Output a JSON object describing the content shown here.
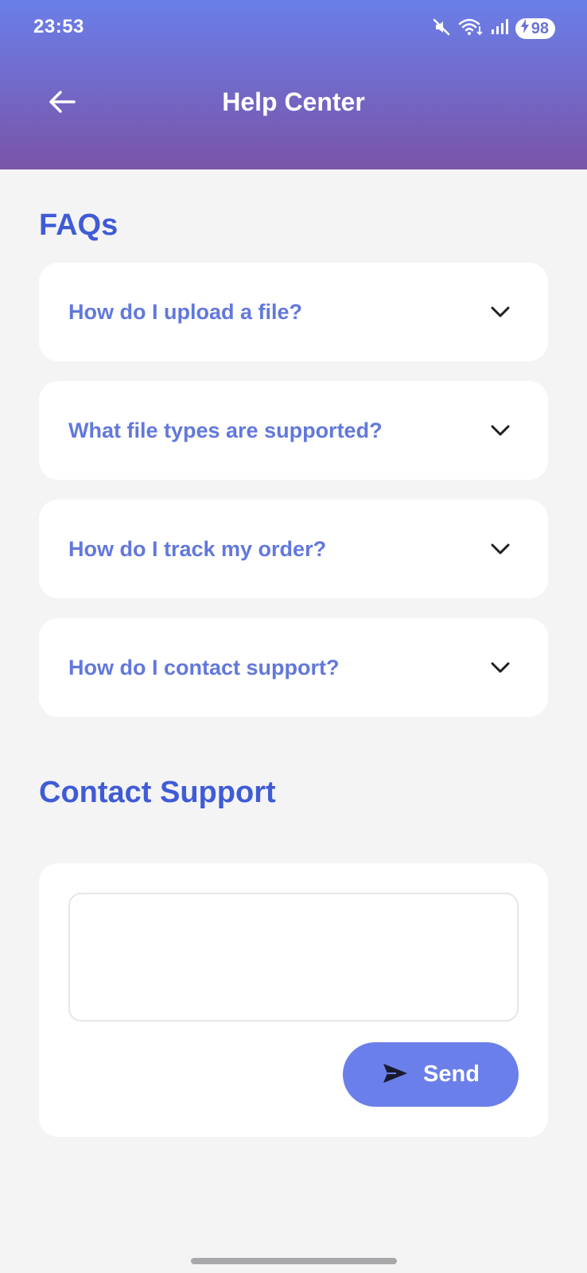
{
  "status_bar": {
    "time": "23:53",
    "battery_level": "98",
    "icons": [
      "mute-icon",
      "wifi-icon",
      "signal-icon",
      "battery-charging-icon"
    ]
  },
  "app_bar": {
    "title": "Help Center",
    "back_icon": "arrow-left-icon"
  },
  "faqs": {
    "title": "FAQs",
    "items": [
      {
        "question": "How do I upload a file?"
      },
      {
        "question": "What file types are supported?"
      },
      {
        "question": "How do I track my order?"
      },
      {
        "question": "How do I contact support?"
      }
    ]
  },
  "contact": {
    "title": "Contact Support",
    "message_value": "",
    "send_label": "Send"
  },
  "colors": {
    "header_gradient_top": "#6a7fe9",
    "header_gradient_bottom": "#7a54a8",
    "accent": "#3f5bd6",
    "faq_text": "#6278db",
    "button": "#6a7fe9",
    "background": "#f4f4f5"
  }
}
